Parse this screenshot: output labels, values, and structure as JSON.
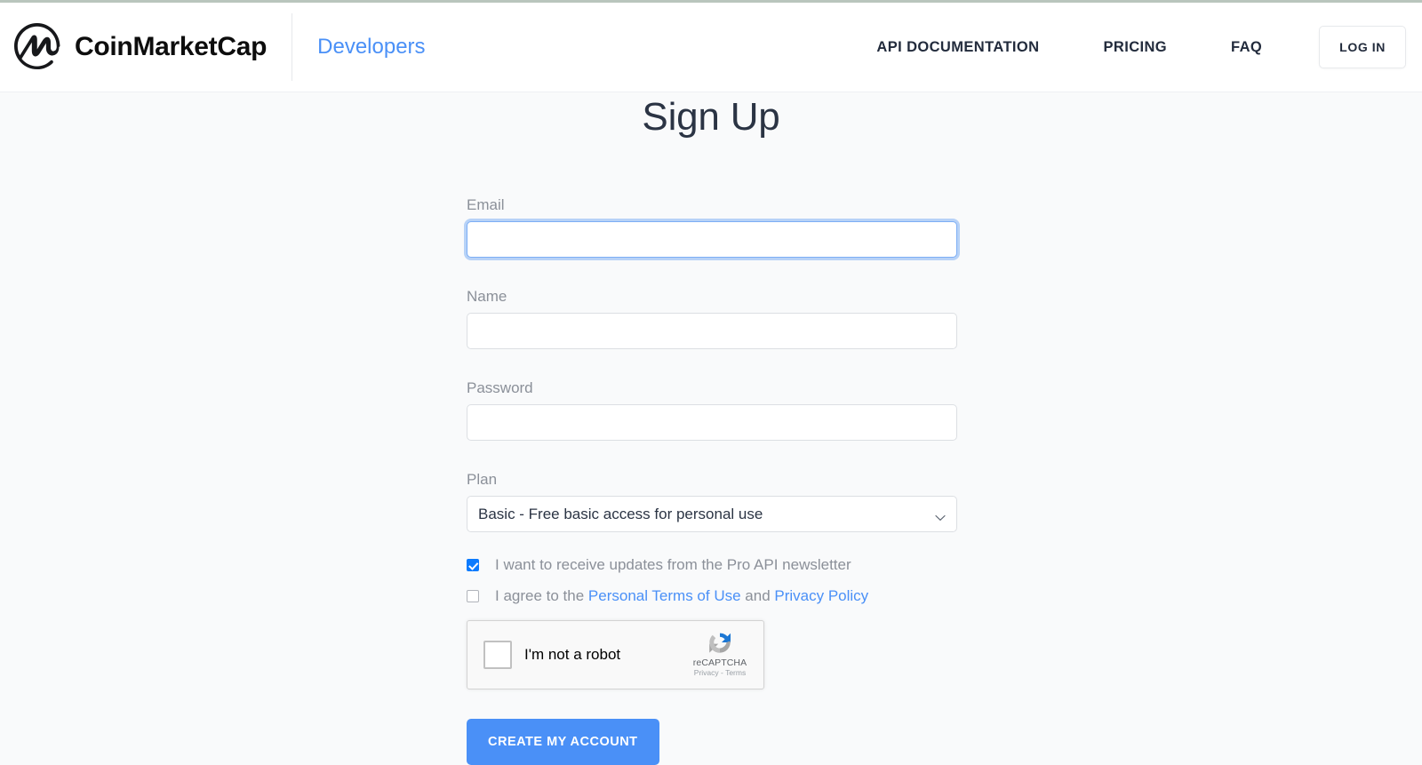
{
  "header": {
    "brand_name": "CoinMarketCap",
    "logo_icon": "coinmarketcap-logo-icon",
    "developers_label": "Developers",
    "nav_items": [
      {
        "label": "API DOCUMENTATION",
        "name": "nav-api-documentation"
      },
      {
        "label": "PRICING",
        "name": "nav-pricing"
      },
      {
        "label": "FAQ",
        "name": "nav-faq"
      }
    ],
    "login_label": "LOG IN"
  },
  "main": {
    "title": "Sign Up",
    "fields": {
      "email": {
        "label": "Email",
        "value": "",
        "placeholder": ""
      },
      "name": {
        "label": "Name",
        "value": "",
        "placeholder": ""
      },
      "password": {
        "label": "Password",
        "value": "",
        "placeholder": ""
      },
      "plan": {
        "label": "Plan",
        "selected": "Basic - Free basic access for personal use",
        "chevron_icon": "chevron-down-icon"
      }
    },
    "checkboxes": {
      "newsletter": {
        "checked": true,
        "label": "I want to receive updates from the Pro API newsletter"
      },
      "terms": {
        "checked": false,
        "label_prefix": "I agree to the ",
        "terms_link": "Personal Terms of Use",
        "label_middle": " and ",
        "privacy_link": "Privacy Policy"
      }
    },
    "recaptcha": {
      "checkbox_checked": false,
      "label": "I'm not a robot",
      "brand": "reCAPTCHA",
      "privacy": "Privacy",
      "separator": " - ",
      "terms": "Terms",
      "logo_icon": "recaptcha-logo-icon"
    },
    "submit_label": "CREATE MY ACCOUNT"
  },
  "colors": {
    "accent_blue": "#4a90f7",
    "checkbox_blue": "#0b7bfe",
    "text_dark": "#2b3444",
    "text_muted": "#8b9099",
    "page_bg": "#f9fafb",
    "header_bg": "#ffffff"
  }
}
